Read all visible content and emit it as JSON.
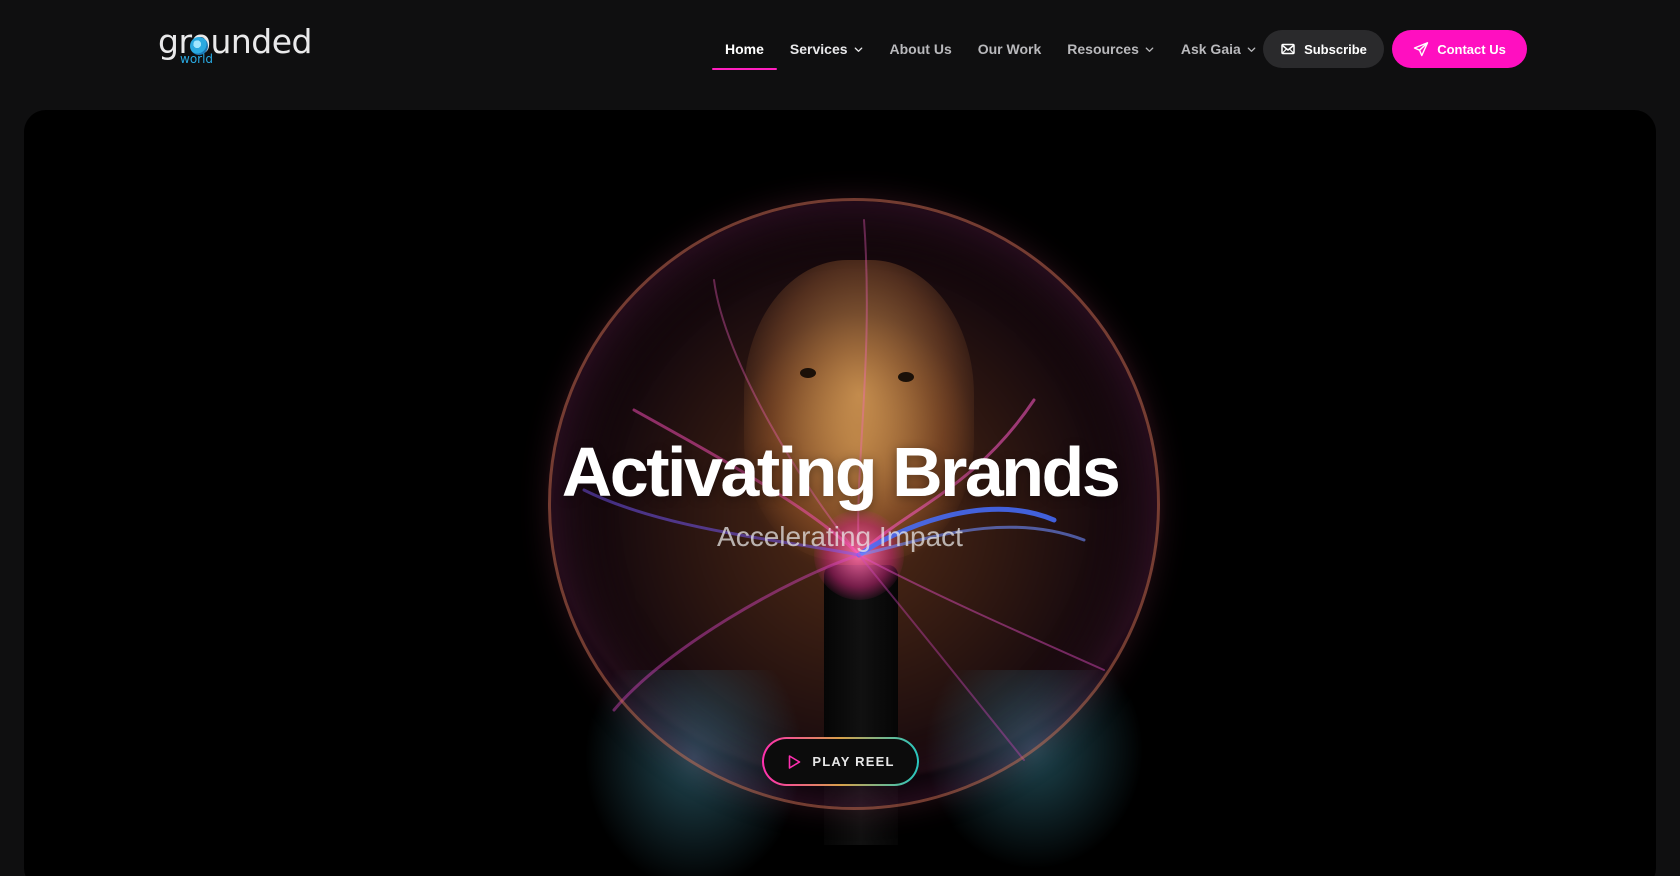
{
  "brand": {
    "name": "grounded",
    "sub": "world"
  },
  "nav": {
    "items": [
      {
        "label": "Home",
        "active": true,
        "dropdown": false
      },
      {
        "label": "Services",
        "active": false,
        "dropdown": true
      },
      {
        "label": "About Us",
        "active": false,
        "dropdown": false
      },
      {
        "label": "Our Work",
        "active": false,
        "dropdown": false
      },
      {
        "label": "Resources",
        "active": false,
        "dropdown": true
      },
      {
        "label": "Ask Gaia",
        "active": false,
        "dropdown": true
      }
    ]
  },
  "actions": {
    "subscribe_label": "Subscribe",
    "contact_label": "Contact Us"
  },
  "hero": {
    "title": "Activating Brands",
    "subtitle": "Accelerating Impact",
    "play_label": "PLAY REEL"
  },
  "colors": {
    "accent": "#ff0fc0",
    "background": "#0f0f10",
    "logo_blue": "#29a9e1"
  },
  "icons": {
    "subscribe": "mail-icon",
    "contact": "send-icon",
    "play": "play-icon",
    "dropdown": "chevron-down-icon"
  }
}
